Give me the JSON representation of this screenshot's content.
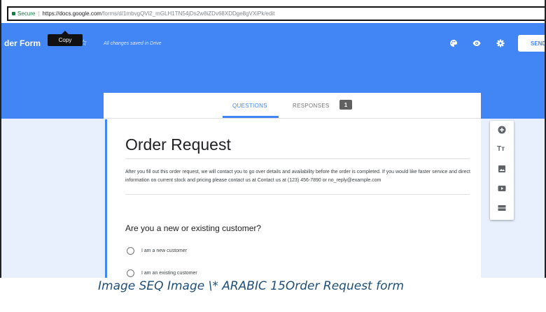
{
  "browser": {
    "secure_label": "Secure",
    "url_host": "https://docs.google.com",
    "url_path": "/forms/d/1mbvgQVi2_mGLH1TN54jDs2w8iZDv68XDDge8gVXiPk/edit"
  },
  "header": {
    "form_title": "der Form",
    "tooltip": "Copy",
    "saved_status": "All changes saved in Drive",
    "send_label": "SEND"
  },
  "tabs": {
    "questions": "QUESTIONS",
    "responses": "RESPONSES",
    "responses_count": "1"
  },
  "form": {
    "title": "Order Request",
    "description": "After you fill out this order request, we will contact you to go over details and availability before the order is completed. If you would like faster service and direct information on current stock and pricing please contact us at Contact us at (123) 456-7890 or no_reply@example.com",
    "question": "Are you a new or existing customer?",
    "options": [
      "I am a new customer",
      "I am an existing customer"
    ]
  },
  "toolbar": {
    "items": [
      "add-question-icon",
      "add-title-icon",
      "add-image-icon",
      "add-video-icon",
      "add-section-icon"
    ],
    "title_glyph": "Tт"
  },
  "caption": "Image  SEQ Image \\* ARABIC 15Order Request form",
  "colors": {
    "accent": "#4285f4",
    "background_tint": "#e8f0fe",
    "caption": "#1f4e79"
  }
}
